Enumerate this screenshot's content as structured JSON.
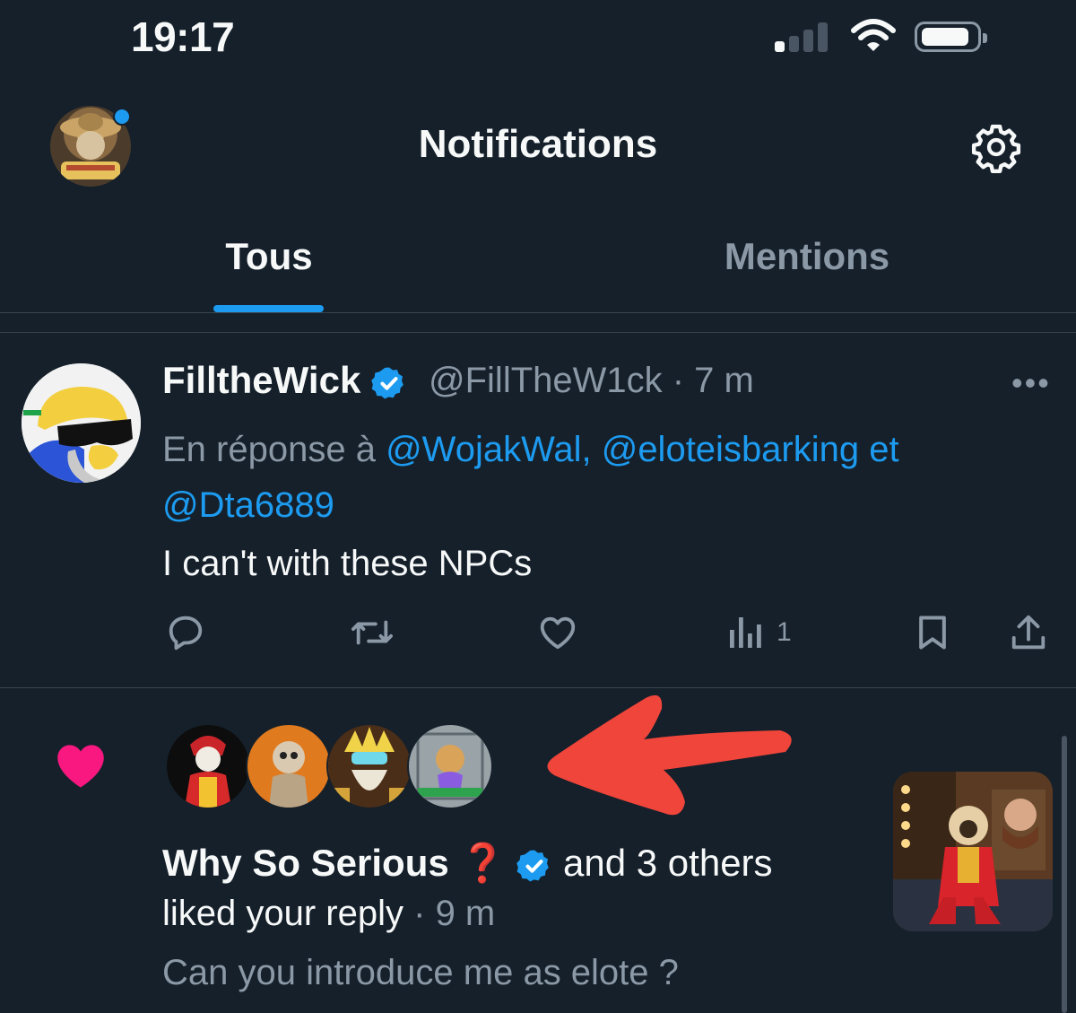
{
  "status_bar": {
    "time": "19:17"
  },
  "header": {
    "title": "Notifications"
  },
  "tabs": [
    {
      "label": "Tous",
      "active": true
    },
    {
      "label": "Mentions",
      "active": false
    }
  ],
  "tweet": {
    "display_name": "FilltheWick",
    "handle_time": "@FillTheW1ck · 7 m",
    "more": "•••",
    "reply_prefix": "En réponse à ",
    "reply_mentions_1": "@WojakWal, @eloteisbarking et",
    "reply_mentions_2": "@Dta6889",
    "text": "I can't with these NPCs",
    "views": "1"
  },
  "notification": {
    "name": "Why So Serious",
    "name_suffix": "❓",
    "others": "and 3 others",
    "action": "liked your reply",
    "time": " · 9 m",
    "quote": "Can you introduce me as elote ?"
  },
  "colors": {
    "background": "#15202b",
    "accent": "#1d9bf0",
    "muted": "#8b98a5",
    "like": "#f91880",
    "arrow": "#f0453a"
  }
}
